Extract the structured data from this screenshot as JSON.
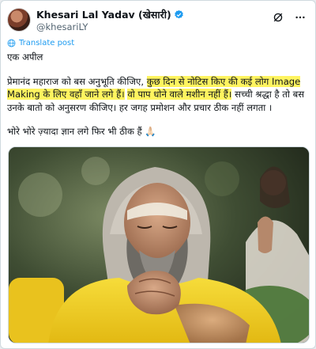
{
  "author": {
    "display_name": "Khesari Lal Yadav (खेसारी)",
    "handle": "@khesariLY",
    "verified": true
  },
  "actions": {
    "grok_icon": "grok-icon",
    "more_icon": "more-icon"
  },
  "translate_label": "Translate post",
  "post": {
    "p1": "एक अपील",
    "p2_seg1": "प्रेमानंद महाराज को बस अनुभूति कीजिए, ",
    "p2_hl1": "कुछ दिन से नोटिस किए की कई लोग Image Making के लिए वहाँ जाने लगे हैं।",
    "p2_seg2": " ",
    "p2_hl2": "वो पाप धोने वाले मशीन नहीं हैं।",
    "p2_seg3": " सच्ची श्रद्धा है तो बस उनके बातो को अनुसरण कीजिए। हर जगह प्रमोशन और प्रचार ठीक नहीं लगता ।",
    "p3": "भोरे भोरे ज़्यादा ज्ञान लगे फिर भी ठीक हैं 🙏🏻"
  },
  "colors": {
    "accent": "#1d9bf0",
    "highlight": "#fff45f",
    "robe": "#f3d324"
  }
}
